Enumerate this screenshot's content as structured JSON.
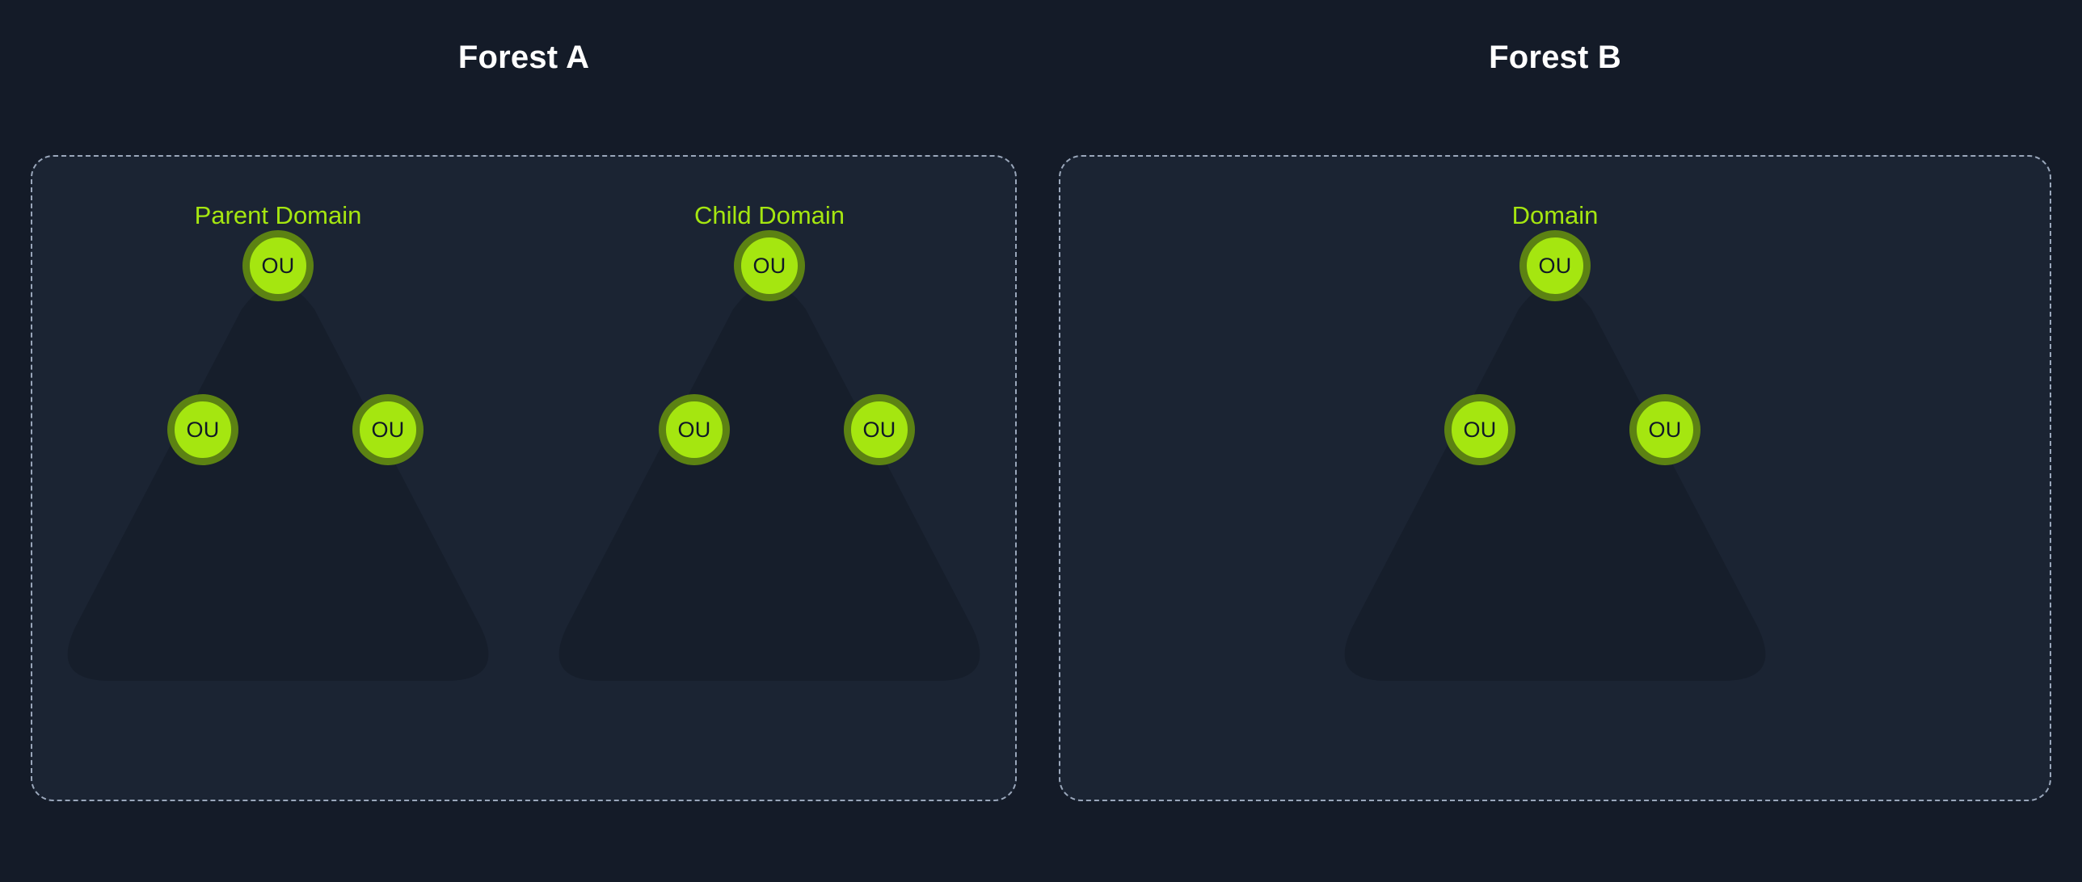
{
  "page": {
    "background_color": "#141b28",
    "card_background_color": "#1b2433",
    "triangle_color": "#161e2b",
    "accent_green": "#a5e610",
    "ring_green": "#5c8213",
    "border_color": "#9aa7bb",
    "title_color": "#ffffff"
  },
  "forests": [
    {
      "title": "Forest A",
      "domains": [
        {
          "label": "Parent Domain",
          "ous": [
            {
              "label": "OU",
              "position": "top"
            },
            {
              "label": "OU",
              "position": "bottom-left"
            },
            {
              "label": "OU",
              "position": "bottom-right"
            }
          ]
        },
        {
          "label": "Child Domain",
          "ous": [
            {
              "label": "OU",
              "position": "top"
            },
            {
              "label": "OU",
              "position": "bottom-left"
            },
            {
              "label": "OU",
              "position": "bottom-right"
            }
          ]
        }
      ]
    },
    {
      "title": "Forest B",
      "domains": [
        {
          "label": "Domain",
          "ous": [
            {
              "label": "OU",
              "position": "top"
            },
            {
              "label": "OU",
              "position": "bottom-left"
            },
            {
              "label": "OU",
              "position": "bottom-right"
            }
          ]
        }
      ]
    }
  ]
}
